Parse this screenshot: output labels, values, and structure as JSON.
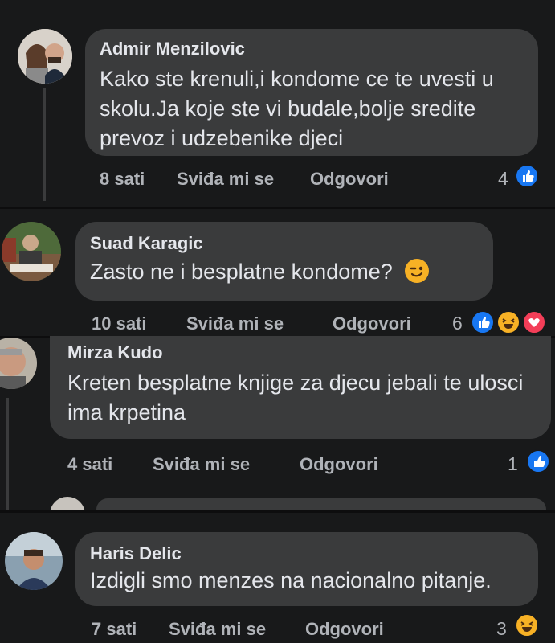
{
  "comments": [
    {
      "name": "Admir Menzilovic",
      "text": "Kako ste krenuli,i kondome ce te uvesti u skolu.Ja koje ste vi budale,bolje sredite prevoz i udzebenike djeci",
      "time": "8 sati",
      "like": "Sviđa mi se",
      "reply": "Odgovori",
      "reactions": "4"
    },
    {
      "name": "Suad Karagic",
      "text": "Zasto ne i besplatne kondome?",
      "time": "10 sati",
      "like": "Sviđa mi se",
      "reply": "Odgovori",
      "reactions": "6"
    },
    {
      "name": "Mirza Kudo",
      "text": "Kreten besplatne knjige za djecu jebali te ulosci ima krpetina",
      "time": "4 sati",
      "like": "Sviđa mi se",
      "reply": "Odgovori",
      "reactions": "1"
    },
    {
      "name": "Haris Delic",
      "text": "Izdigli smo menzes na nacionalno pitanje.",
      "time": "7 sati",
      "like": "Sviđa mi se",
      "reply": "Odgovori",
      "reactions": "3"
    }
  ],
  "colors": {
    "background": "#18191a",
    "bubble": "#3a3b3c",
    "like": "#1877f2",
    "haha": "#f7b125",
    "love": "#f33e58"
  }
}
